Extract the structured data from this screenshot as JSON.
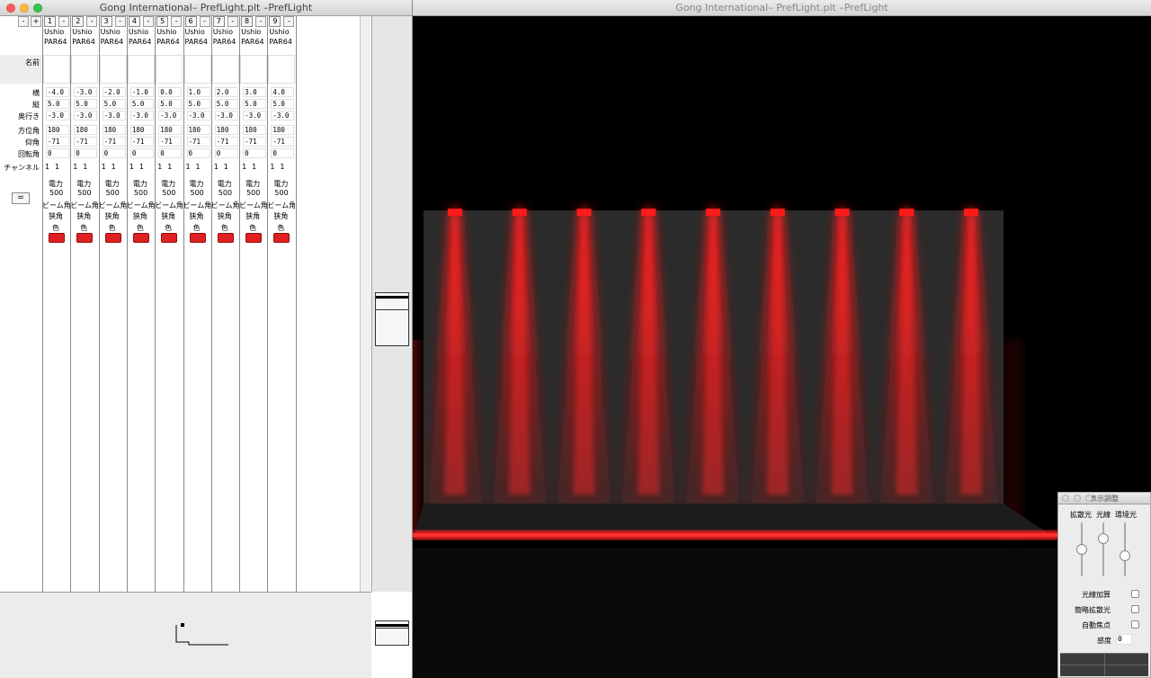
{
  "left_window": {
    "title": "Gong International– PrefLight.plt –PrefLight",
    "toolbar_minus": "-",
    "toolbar_plus": "+",
    "labels": {
      "name": "名前",
      "x": "横",
      "y": "縦",
      "z": "奥行き",
      "azimuth": "方位角",
      "elevation": "仰角",
      "rotation": "回転角",
      "channel": "チャンネル",
      "equal": "="
    },
    "fixtures": [
      {
        "num": "1",
        "make": "Ushio",
        "model": "PAR64",
        "x": "-4.0",
        "y": "5.0",
        "z": "-3.0",
        "az": "180",
        "el": "-71",
        "rot": "0",
        "ch_a": "1",
        "ch_b": "1",
        "power_label": "電力",
        "power": "500",
        "beam_label": "ビーム角",
        "beam": "狭角",
        "color_label": "色"
      },
      {
        "num": "2",
        "make": "Ushio",
        "model": "PAR64",
        "x": "-3.0",
        "y": "5.0",
        "z": "-3.0",
        "az": "180",
        "el": "-71",
        "rot": "0",
        "ch_a": "1",
        "ch_b": "1",
        "power_label": "電力",
        "power": "500",
        "beam_label": "ビーム角",
        "beam": "狭角",
        "color_label": "色"
      },
      {
        "num": "3",
        "make": "Ushio",
        "model": "PAR64",
        "x": "-2.0",
        "y": "5.0",
        "z": "-3.0",
        "az": "180",
        "el": "-71",
        "rot": "0",
        "ch_a": "1",
        "ch_b": "1",
        "power_label": "電力",
        "power": "500",
        "beam_label": "ビーム角",
        "beam": "狭角",
        "color_label": "色"
      },
      {
        "num": "4",
        "make": "Ushio",
        "model": "PAR64",
        "x": "-1.0",
        "y": "5.0",
        "z": "-3.0",
        "az": "180",
        "el": "-71",
        "rot": "0",
        "ch_a": "1",
        "ch_b": "1",
        "power_label": "電力",
        "power": "500",
        "beam_label": "ビーム角",
        "beam": "狭角",
        "color_label": "色"
      },
      {
        "num": "5",
        "make": "Ushio",
        "model": "PAR64",
        "x": "0.0",
        "y": "5.0",
        "z": "-3.0",
        "az": "180",
        "el": "-71",
        "rot": "0",
        "ch_a": "1",
        "ch_b": "1",
        "power_label": "電力",
        "power": "500",
        "beam_label": "ビーム角",
        "beam": "狭角",
        "color_label": "色"
      },
      {
        "num": "6",
        "make": "Ushio",
        "model": "PAR64",
        "x": "1.0",
        "y": "5.0",
        "z": "-3.0",
        "az": "180",
        "el": "-71",
        "rot": "0",
        "ch_a": "1",
        "ch_b": "1",
        "power_label": "電力",
        "power": "500",
        "beam_label": "ビーム角",
        "beam": "狭角",
        "color_label": "色"
      },
      {
        "num": "7",
        "make": "Ushio",
        "model": "PAR64",
        "x": "2.0",
        "y": "5.0",
        "z": "-3.0",
        "az": "180",
        "el": "-71",
        "rot": "0",
        "ch_a": "1",
        "ch_b": "1",
        "power_label": "電力",
        "power": "500",
        "beam_label": "ビーム角",
        "beam": "狭角",
        "color_label": "色"
      },
      {
        "num": "8",
        "make": "Ushio",
        "model": "PAR64",
        "x": "3.0",
        "y": "5.0",
        "z": "-3.0",
        "az": "180",
        "el": "-71",
        "rot": "0",
        "ch_a": "1",
        "ch_b": "1",
        "power_label": "電力",
        "power": "500",
        "beam_label": "ビーム角",
        "beam": "狭角",
        "color_label": "色"
      },
      {
        "num": "9",
        "make": "Ushio",
        "model": "PAR64",
        "x": "4.0",
        "y": "5.0",
        "z": "-3.0",
        "az": "180",
        "el": "-71",
        "rot": "0",
        "ch_a": "1",
        "ch_b": "1",
        "power_label": "電力",
        "power": "500",
        "beam_label": "ビーム角",
        "beam": "狭角",
        "color_label": "色"
      }
    ],
    "fixture_color": "#e02020"
  },
  "right_window": {
    "title": "Gong International– PrefLight.plt –PrefLight",
    "beam_color": "#ff1a1a",
    "backdrop_color": "#2b2b2b",
    "beam_count": 9
  },
  "adjust_panel": {
    "title": "表示調整",
    "slider_labels": [
      "拡散光",
      "光線",
      "環境光"
    ],
    "sliders": [
      0.5,
      0.3,
      0.62
    ],
    "checkboxes": [
      {
        "label": "光線加算",
        "checked": false
      },
      {
        "label": "簡略拡散光",
        "checked": false
      },
      {
        "label": "自動焦点",
        "checked": false
      }
    ],
    "sensitivity_label": "感度",
    "sensitivity_value": "0"
  }
}
